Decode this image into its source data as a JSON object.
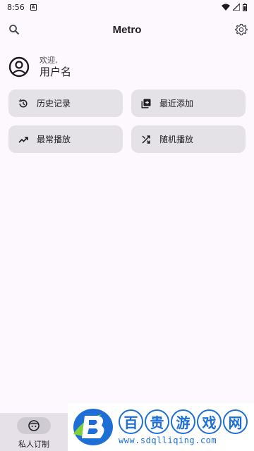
{
  "status_bar": {
    "time": "8:56",
    "notification_glyph": "A"
  },
  "app_bar": {
    "title": "Metro"
  },
  "user": {
    "welcome": "欢迎,",
    "name": "用户名"
  },
  "tiles": [
    {
      "label": "历史记录",
      "icon": "history-icon"
    },
    {
      "label": "最近添加",
      "icon": "library-add-icon"
    },
    {
      "label": "最常播放",
      "icon": "trending-up-icon"
    },
    {
      "label": "随机播放",
      "icon": "shuffle-icon"
    }
  ],
  "bottom_nav": {
    "label": "私人订制",
    "icon": "face-icon"
  },
  "watermark": {
    "chars": [
      "百",
      "贵",
      "游",
      "戏",
      "网"
    ],
    "url": "www.sdqlliqing.com"
  },
  "colors": {
    "background": "#fdf8fd",
    "tile": "#e4e2e6",
    "watermark": "#1d6fd6"
  }
}
